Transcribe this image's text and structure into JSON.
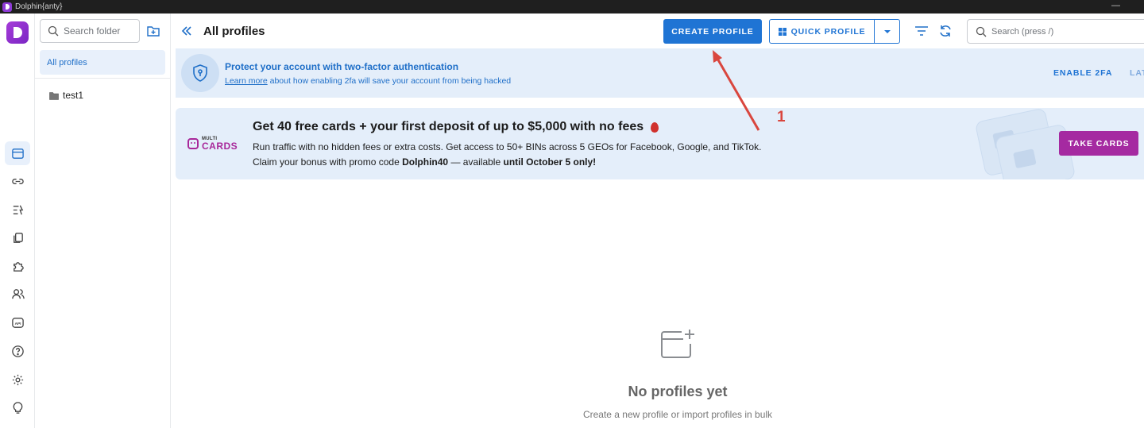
{
  "window": {
    "title": "Dolphin{anty}",
    "minimize_glyph": "—"
  },
  "rail": {
    "items": [
      {
        "name": "browser-profiles-icon",
        "active": true
      },
      {
        "name": "link-icon",
        "active": false
      },
      {
        "name": "automation-icon",
        "active": false
      },
      {
        "name": "copy-icon",
        "active": false
      },
      {
        "name": "extensions-icon",
        "active": false
      },
      {
        "name": "users-icon",
        "active": false
      },
      {
        "name": "api-icon",
        "active": false
      },
      {
        "name": "help-icon",
        "active": false
      },
      {
        "name": "settings-icon",
        "active": false
      },
      {
        "name": "lightbulb-icon",
        "active": false
      }
    ]
  },
  "folders": {
    "search_placeholder": "Search folder",
    "all_label": "All profiles",
    "items": [
      {
        "label": "test1"
      }
    ]
  },
  "header": {
    "title": "All profiles",
    "create_label": "CREATE PROFILE",
    "quick_label": "QUICK PROFILE",
    "search_placeholder": "Search (press /)"
  },
  "twofa": {
    "title": "Protect your account with two-factor authentication",
    "link": "Learn more",
    "subtitle_rest": " about how enabling 2fa will save your account from being hacked",
    "enable_label": "ENABLE 2FA",
    "later_label": "LATER"
  },
  "promo": {
    "logo_small": "MULTI",
    "logo_big": "CARDS",
    "title": "Get 40 free cards + your first deposit of up to $5,000 with no fees",
    "line1": "Run traffic with no hidden fees or extra costs. Get access to 50+ BINs across 5 GEOs for Facebook, Google, and TikTok.",
    "line2_pre": "Claim your bonus with promo code ",
    "promo_code": "Dolphin40",
    "line2_mid": " — available ",
    "deadline": "until October 5 only!",
    "cta_label": "TAKE CARDS"
  },
  "empty": {
    "title": "No profiles yet",
    "subtitle": "Create a new profile or import profiles in bulk"
  },
  "annotation": {
    "label": "1",
    "color": "#d9463e"
  },
  "colors": {
    "primary": "#1f74d4",
    "banner_bg": "#e4eefa",
    "promo_accent": "#a52aa1"
  }
}
